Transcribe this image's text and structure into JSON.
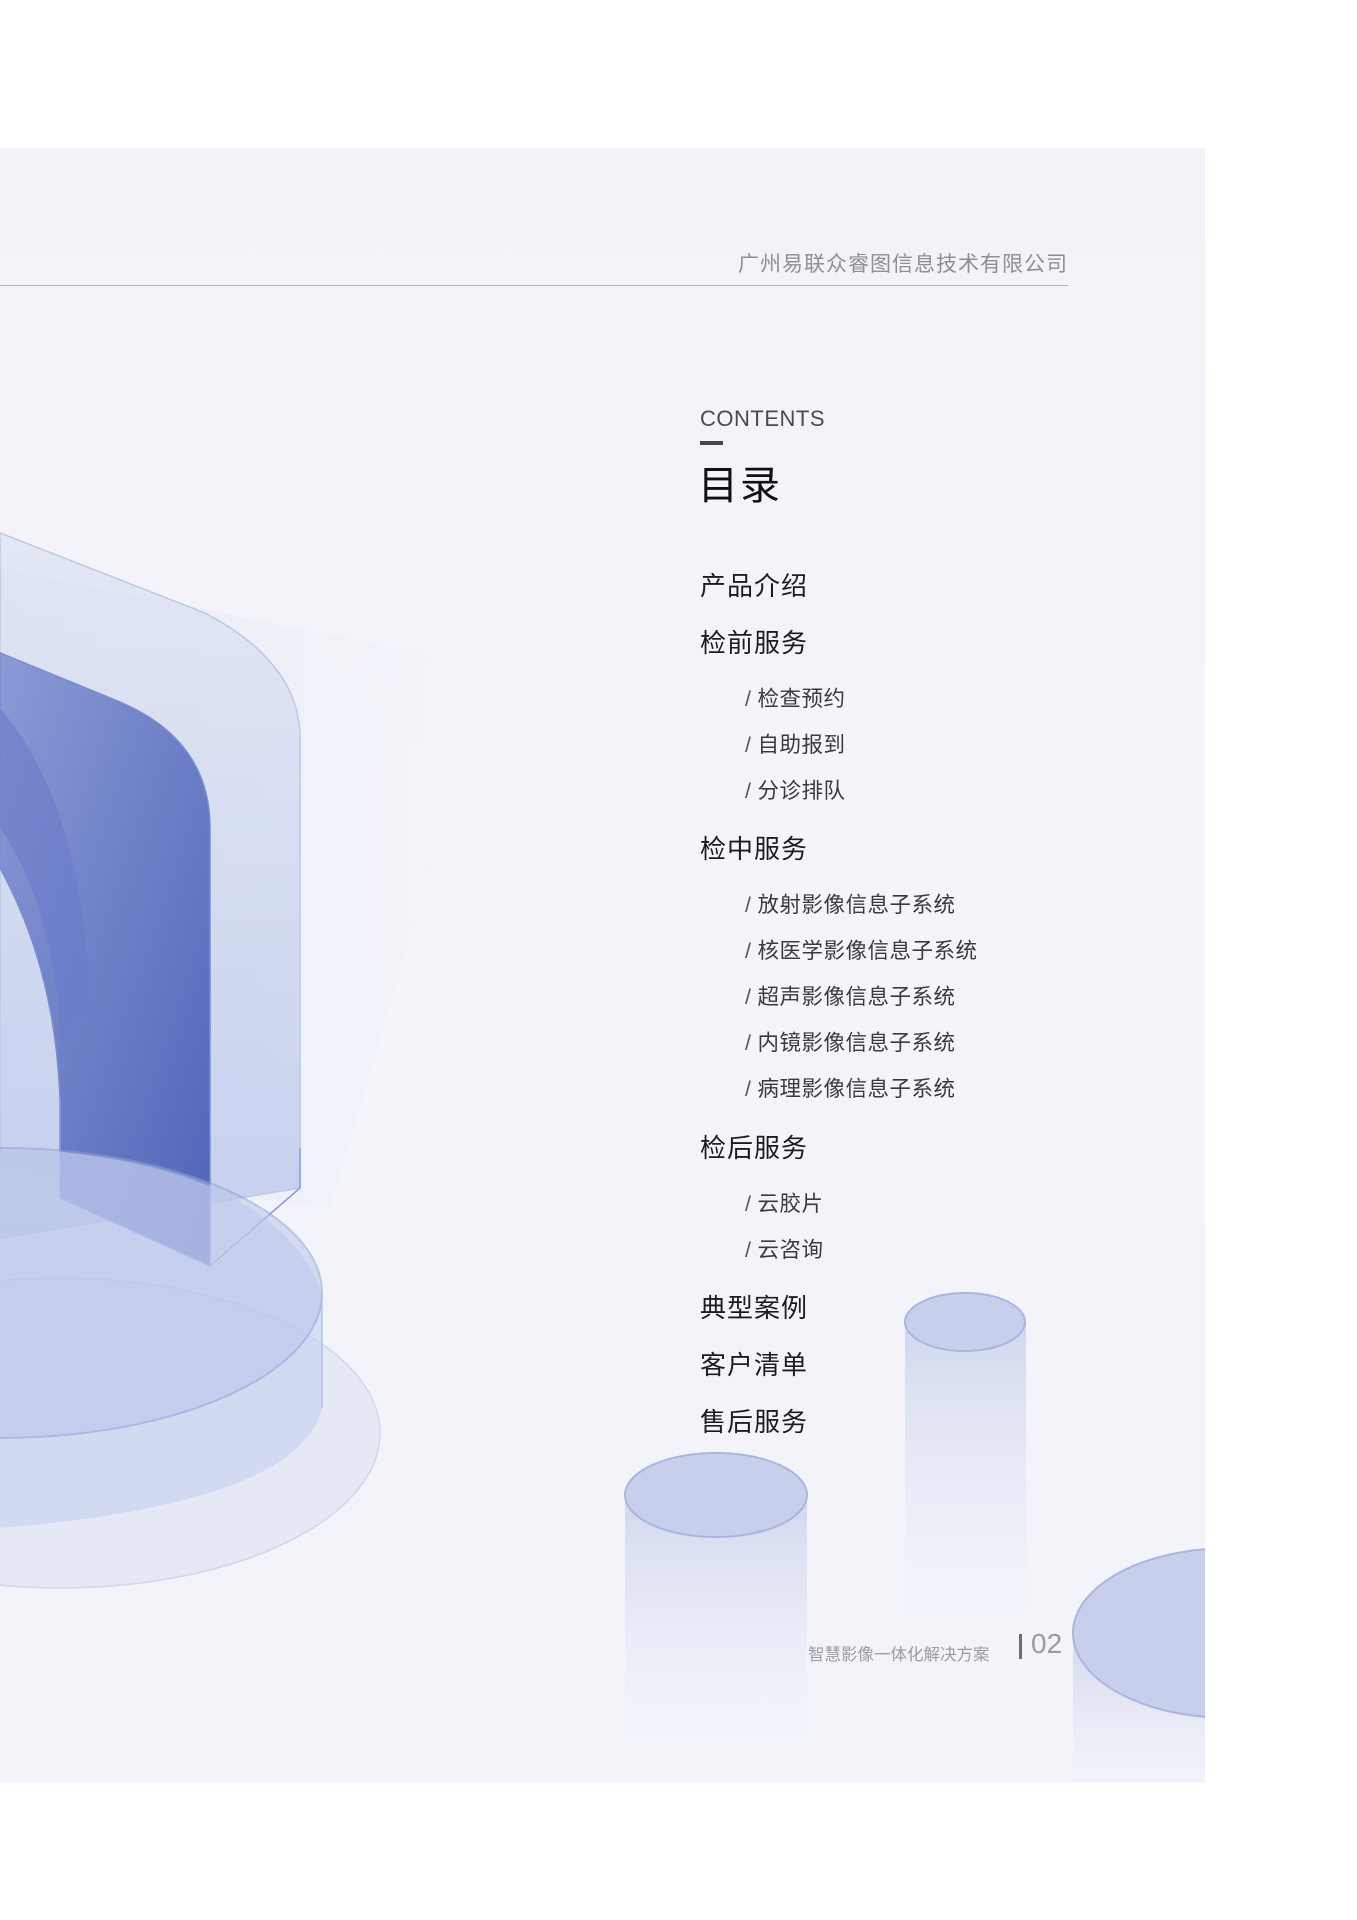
{
  "header": {
    "company": "广州易联众睿图信息技术有限公司"
  },
  "contents": {
    "label": "CONTENTS",
    "title": "目录"
  },
  "toc": {
    "sections": [
      {
        "title": "产品介绍",
        "items": []
      },
      {
        "title": "检前服务",
        "items": [
          "检查预约",
          "自助报到",
          "分诊排队"
        ]
      },
      {
        "title": "检中服务",
        "items": [
          "放射影像信息子系统",
          "核医学影像信息子系统",
          "超声影像信息子系统",
          "内镜影像信息子系统",
          "病理影像信息子系统"
        ]
      },
      {
        "title": "检后服务",
        "items": [
          "云胶片",
          "云咨询"
        ]
      },
      {
        "title": "典型案例",
        "items": []
      },
      {
        "title": "客户清单",
        "items": []
      },
      {
        "title": "售后服务",
        "items": []
      }
    ],
    "separator": "/"
  },
  "footer": {
    "doc_title": "智慧影像一体化解决方案",
    "page_number": "02"
  },
  "colors": {
    "accent": "#5b6fc0",
    "light_blue": "#c9d2ee",
    "text": "#1d1d1f"
  }
}
